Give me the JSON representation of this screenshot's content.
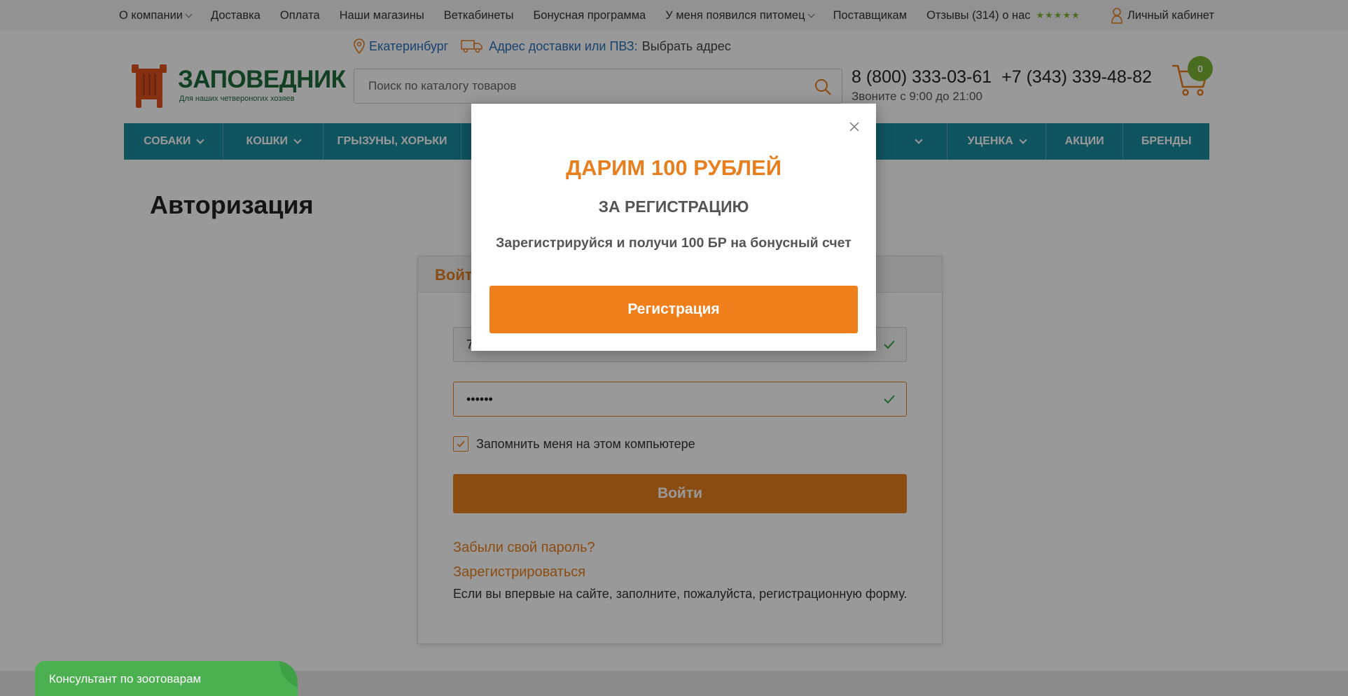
{
  "topbar": {
    "items": [
      {
        "label": "О компании",
        "has_dropdown": true
      },
      {
        "label": "Доставка",
        "has_dropdown": false
      },
      {
        "label": "Оплата",
        "has_dropdown": false
      },
      {
        "label": "Наши магазины",
        "has_dropdown": false
      },
      {
        "label": "Веткабинеты",
        "has_dropdown": false
      },
      {
        "label": "Бонусная программа",
        "has_dropdown": false
      },
      {
        "label": "У меня появился питомец",
        "has_dropdown": true
      },
      {
        "label": "Поставщикам",
        "has_dropdown": false
      }
    ],
    "reviews_label": "Отзывы (314) о нас",
    "stars": "★★★★★",
    "account_label": "Личный кабинет"
  },
  "location": {
    "city": "Екатеринбург",
    "delivery_label": "Адрес доставки или ПВЗ:",
    "delivery_value": "Выбрать адрес"
  },
  "header": {
    "logo_name": "ЗАПОВЕДНИК",
    "logo_tagline": "Для наших четвероногих хозяев",
    "search_placeholder": "Поиск по каталогу товаров",
    "phone_1": "8 (800) 333-03-61",
    "phone_2": "+7 (343) 339-48-82",
    "hours": "Звоните с 9:00 до 21:00",
    "cart_count": "0"
  },
  "nav": {
    "items": [
      {
        "label": "Собаки",
        "has_dropdown": true
      },
      {
        "label": "Кошки",
        "has_dropdown": true
      },
      {
        "label": "Грызуны, хорьки",
        "has_dropdown": false
      },
      {
        "label": "",
        "has_dropdown": true
      },
      {
        "label": "Уценка",
        "has_dropdown": true
      },
      {
        "label": "Акции",
        "has_dropdown": false
      },
      {
        "label": "Бренды",
        "has_dropdown": false
      }
    ]
  },
  "page": {
    "title": "Авторизация",
    "tab_label": "Войти",
    "login_value": "7",
    "password_value": "••••••",
    "remember_label": "Запомнить меня на этом компьютере",
    "login_button": "Войти",
    "forgot_link": "Забыли свой пароль?",
    "register_link": "Зарегистрироваться",
    "register_note": "Если вы впервые на сайте, заполните, пожалуйста, регистрационную форму."
  },
  "modal": {
    "title": "ДАРИМ 100 РУБЛЕЙ",
    "subtitle": "ЗА РЕГИСТРАЦИЮ",
    "text": "Зарегистрируйся и получи 100 БР на бонусный счет",
    "button": "Регистрация"
  },
  "consultant": {
    "label": "Консультант по зоотоварам"
  },
  "colors": {
    "accent": "#e87f1e",
    "nav_bg": "#1b8c9f",
    "brand_green": "#1d6b3a",
    "badge_green": "#7ab534"
  }
}
